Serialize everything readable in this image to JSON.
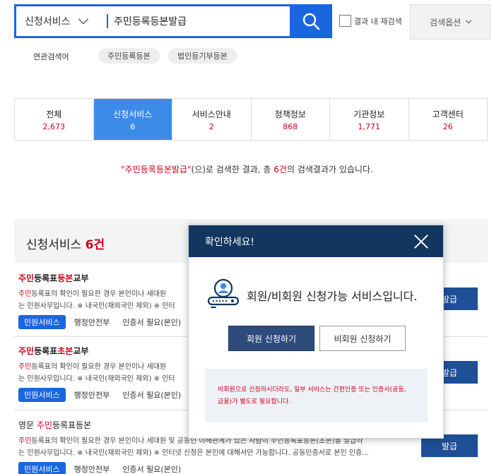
{
  "search": {
    "scope": "신청서비스",
    "query": "주민등록등본발급",
    "resubmit_label": "결과 내 재검색",
    "options_label": "검색옵션"
  },
  "related": {
    "label": "연관검색어",
    "tags": [
      "주민등록등본",
      "법인등기부등본"
    ]
  },
  "tabs": [
    {
      "name": "전체",
      "count": "2,673"
    },
    {
      "name": "신청서비스",
      "count": "6"
    },
    {
      "name": "서비스안내",
      "count": "2"
    },
    {
      "name": "정책정보",
      "count": "868"
    },
    {
      "name": "기관정보",
      "count": "1,771"
    },
    {
      "name": "고객센터",
      "count": "26"
    }
  ],
  "summary": {
    "keyword": "\"주민등록등본발급\"",
    "text1": "(으)로 검색한 결과, 총 ",
    "count": "6건",
    "text2": "의 검색결과가 있습니다."
  },
  "results": {
    "title": "신청서비스",
    "count": "6건",
    "items": [
      {
        "title_hl1": "주민",
        "title_mid": "등록표",
        "title_hl2": "등본",
        "title_rest": "교부",
        "desc1_hl": "주민",
        "desc1": "등록표의 확인이 필요한 경우 본인이나 세대원",
        "desc2": "는 민원사무입니다. ※ 내국인(재외국인 제외) ※ 인터",
        "badge": "민원서비스",
        "agency": "행정안전부",
        "auth": "인증서 필요(본인)",
        "button": "발급"
      },
      {
        "title_hl1": "주민",
        "title_mid": "등록표",
        "title_hl2": "초본",
        "title_rest": "교부",
        "desc1_hl": "주민",
        "desc1": "등록표의 확인이 필요한 경우 본인이나 세대원",
        "desc2": "는 민원사무입니다. ※ 내국인(재외국인 제외) ※ 인터",
        "badge": "민원서비스",
        "agency": "행정안전부",
        "auth": "인증서 필요(본인)",
        "button": "발급"
      },
      {
        "title_pre": "영문 ",
        "title_hl1": "주민",
        "title_rest": "등록표등본",
        "desc1_hl": "주민",
        "desc1": "등록표의 확인이 필요한 경우 본인이나 세대원 및 공동인 이해관계가 있는 사람이 주민등록표등본(초본)을 발급하",
        "desc2": "는 민원사무입니다. ※ 내국인(재외국인 제외) ※ 인터넷 신청은 본인에 대해서만 가능합니다. 공동인증서로 본인 인증...",
        "badge": "민원서비스",
        "agency": "행정안전부",
        "auth": "인증서 필요(본인)",
        "button": "발급"
      }
    ]
  },
  "modal": {
    "title": "확인하세요!",
    "message": "회원/비회원 신청가능 서비스입니다.",
    "member_button": "회원 신청하기",
    "guest_button": "비회원 신청하기",
    "notice": "비회원으로 신청하시더라도, 일부 서비스는 간편인증 또는 인증서(공동, 금융)가 별도로 필요합니다."
  },
  "colors": {
    "primary": "#1a66e0",
    "tab_active": "#3d8be8",
    "highlight": "#d0021b",
    "modal_header": "#12365f",
    "issue_button": "#1e4f97"
  }
}
